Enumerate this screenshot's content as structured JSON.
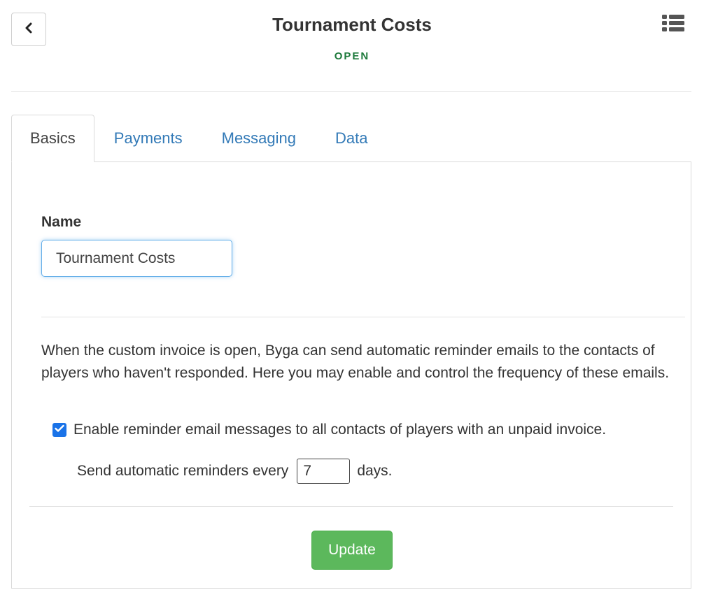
{
  "header": {
    "title": "Tournament Costs",
    "status": "OPEN",
    "status_color": "#1e7a3c",
    "back_icon": "chevron-left-icon",
    "menu_icon": "list-icon"
  },
  "tabs": [
    {
      "label": "Basics",
      "active": true
    },
    {
      "label": "Payments",
      "active": false
    },
    {
      "label": "Messaging",
      "active": false
    },
    {
      "label": "Data",
      "active": false
    }
  ],
  "form": {
    "name_label": "Name",
    "name_value": "Tournament Costs",
    "description": "When the custom invoice is open, Byga can send automatic reminder emails to the contacts of players who haven't responded. Here you may enable and control the frequency of these emails.",
    "reminder_checkbox_label": "Enable reminder email messages to all contacts of players with an unpaid invoice.",
    "reminder_checked": true,
    "frequency_prefix": "Send automatic reminders every",
    "frequency_value": "7",
    "frequency_suffix": "days.",
    "update_label": "Update"
  },
  "colors": {
    "accent_link": "#337ab7",
    "checkbox": "#1a73e8",
    "update_button": "#5cb85c"
  }
}
